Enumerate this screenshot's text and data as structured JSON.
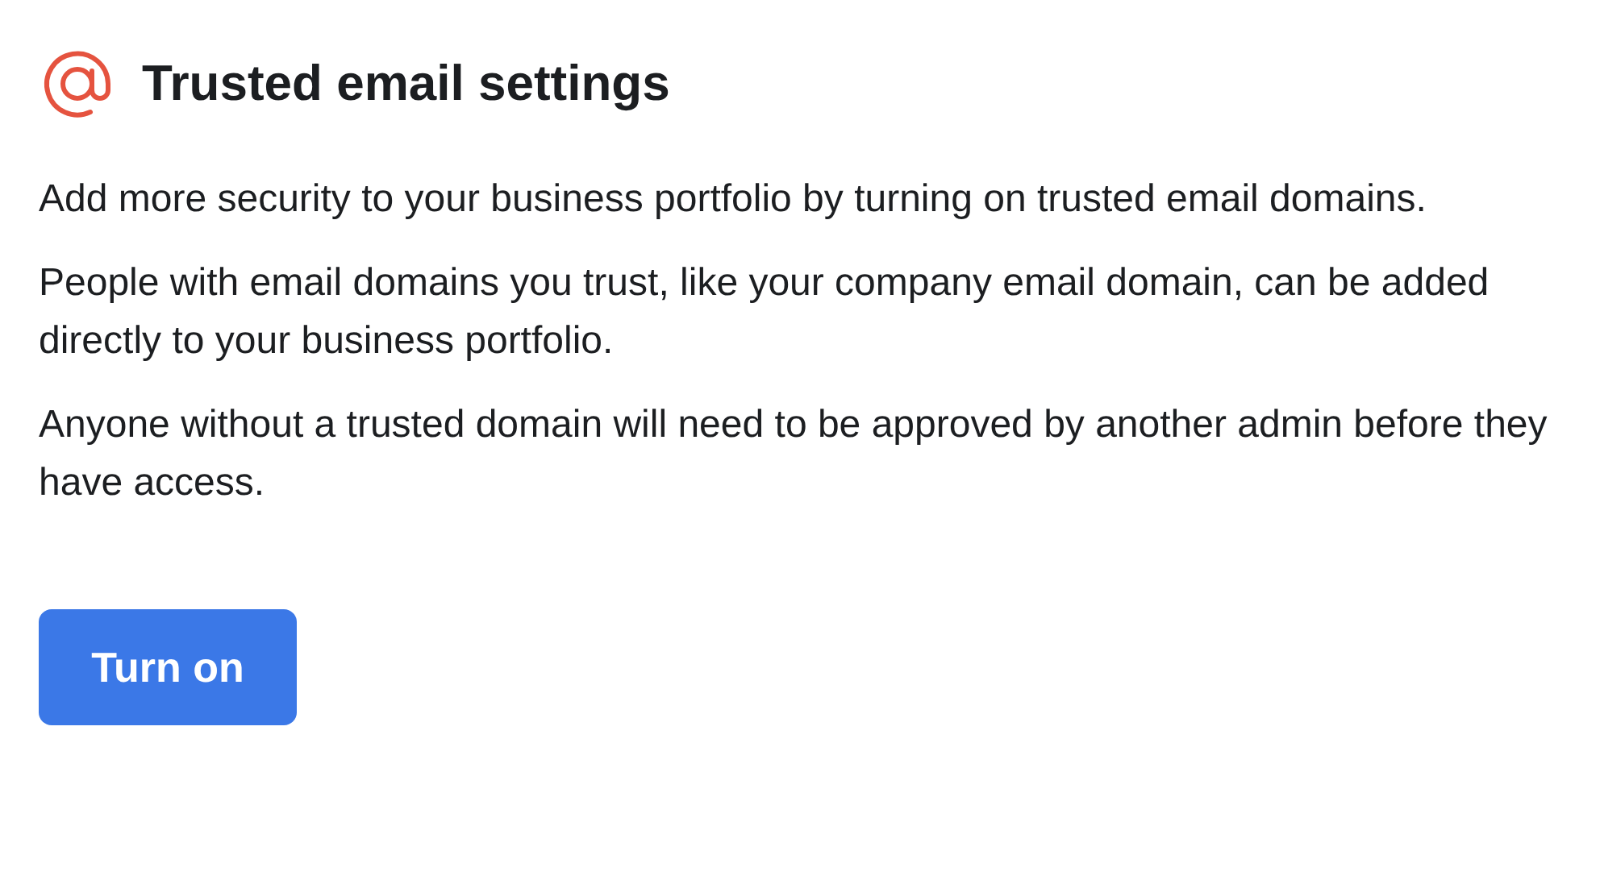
{
  "header": {
    "title": "Trusted email settings"
  },
  "paragraphs": [
    "Add more security to your business portfolio by turning on trusted email domains.",
    "People with email domains you trust, like your company email domain, can be added directly to your business portfolio.",
    "Anyone without a trusted domain will need to be approved by another admin before they have access."
  ],
  "button": {
    "label": "Turn on"
  }
}
